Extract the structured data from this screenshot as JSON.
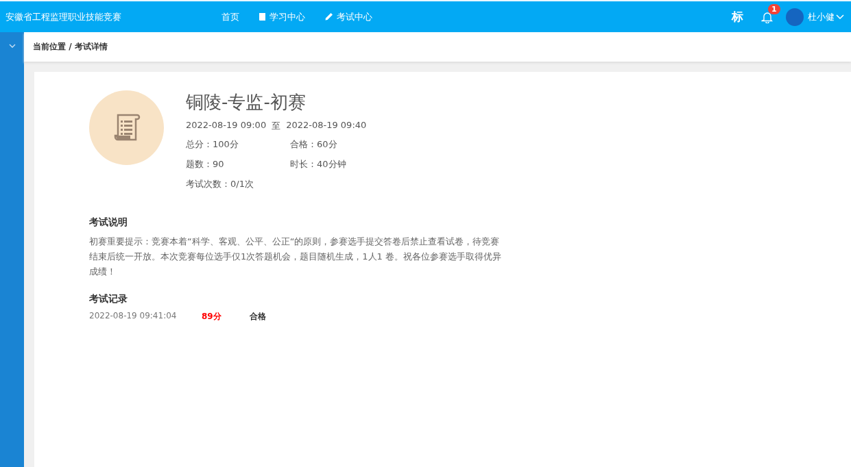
{
  "header": {
    "site_title": "安徽省工程监理职业技能竞赛",
    "nav": [
      {
        "label": "首页"
      },
      {
        "label": "学习中心"
      },
      {
        "label": "考试中心"
      }
    ],
    "mark": "标",
    "notification_count": "1",
    "user_name": "杜小健"
  },
  "breadcrumb": "当前位置 / 考试详情",
  "exam": {
    "title": "铜陵-专监-初赛",
    "start": "2022-08-19 09:00",
    "range_separator": "至",
    "end": "2022-08-19 09:40",
    "facts": [
      {
        "label": "总分：",
        "value": "100分"
      },
      {
        "label": "合格：",
        "value": "60分"
      },
      {
        "label": "题数：",
        "value": "90"
      },
      {
        "label": "时长：",
        "value": "40分钟"
      },
      {
        "label": "考试次数：",
        "value": "0/1次"
      }
    ]
  },
  "description": {
    "heading": "考试说明",
    "text": "初赛重要提示：竞赛本着“科学、客观、公平、公正“的原则，参赛选手提交答卷后禁止查看试卷，待竞赛结束后统一开放。本次竞赛每位选手仅1次答题机会，题目随机生成，1人1 卷。祝各位参赛选手取得优异成绩！"
  },
  "records": {
    "heading": "考试记录",
    "rows": [
      {
        "time": "2022-08-19 09:41:04",
        "score": "89分",
        "result": "合格"
      }
    ]
  }
}
